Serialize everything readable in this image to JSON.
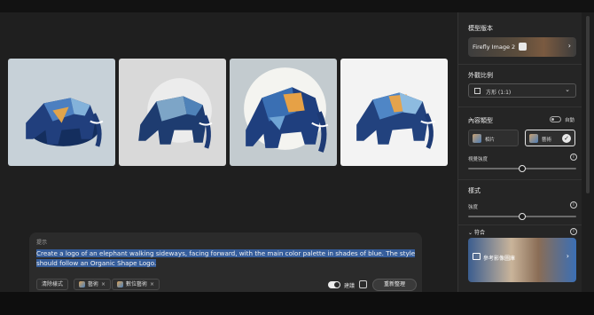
{
  "prompt": {
    "label": "提示",
    "text": "Create a logo of an elephant walking sideways, facing forward, with the main color palette in shades of blue. The style should follow an Organic Shape Logo.",
    "chips": [
      "清除樣式",
      "藝術",
      "數位藝術"
    ],
    "toggle_label": "建議",
    "regenerate_label": "重新整理"
  },
  "panel": {
    "model_section": "模型版本",
    "model_value": "Firefly Image 2",
    "aspect_section": "外觀比例",
    "aspect_value": "方形 (1:1)",
    "content_section": "內容類型",
    "auto_label": "自動",
    "content_options": [
      "相片",
      "藝術"
    ],
    "visual_intensity": "視覺強度",
    "style_section": "樣式",
    "strength_label": "強度",
    "match_label": "符合",
    "reference_label": "參考影像圖庫"
  },
  "sliders": {
    "visual_intensity": 0.5,
    "strength": 0.5
  },
  "colors": {
    "accent_highlight": "#355d9b",
    "panel_bg": "#252525",
    "canvas_bg": "#1f1f1f"
  },
  "icons": [
    "elephant-logo",
    "chevron-right-icon",
    "chevron-down-icon",
    "info-icon",
    "check-icon",
    "image-icon"
  ]
}
